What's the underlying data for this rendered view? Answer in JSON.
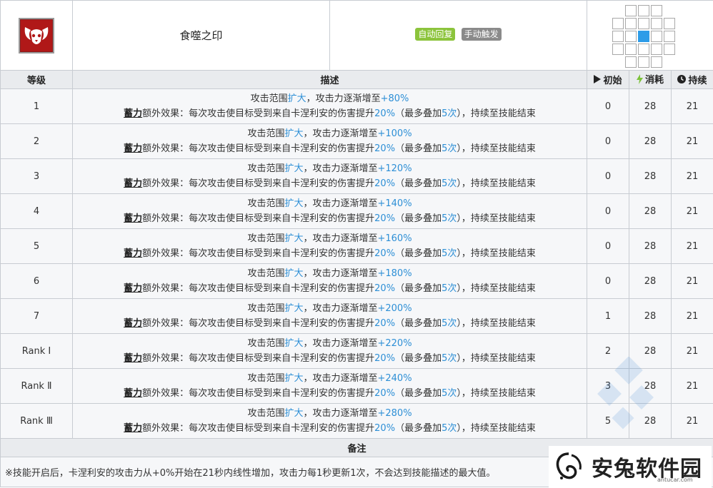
{
  "skill": {
    "name": "食噬之印",
    "tags": [
      "自动回复",
      "手动触发"
    ],
    "icon": "ram-skull-icon"
  },
  "range_grid": [
    [
      0,
      1,
      1,
      1,
      0,
      0
    ],
    [
      1,
      1,
      1,
      1,
      1,
      0
    ],
    [
      1,
      1,
      2,
      1,
      1,
      0
    ],
    [
      1,
      1,
      1,
      1,
      1,
      0
    ],
    [
      0,
      1,
      1,
      1,
      0,
      0
    ]
  ],
  "header": {
    "level": "等级",
    "desc": "描述",
    "initial": "初始",
    "cost": "消耗",
    "duration": "持续"
  },
  "rows": [
    {
      "level": "1",
      "range": "扩大",
      "atk": "+80%",
      "initial": "0",
      "cost": "28",
      "duration": "21"
    },
    {
      "level": "2",
      "range": "扩大",
      "atk": "+100%",
      "initial": "0",
      "cost": "28",
      "duration": "21"
    },
    {
      "level": "3",
      "range": "扩大",
      "atk": "+120%",
      "initial": "0",
      "cost": "28",
      "duration": "21"
    },
    {
      "level": "4",
      "range": "扩大",
      "atk": "+140%",
      "initial": "0",
      "cost": "28",
      "duration": "21"
    },
    {
      "level": "5",
      "range": "扩大",
      "atk": "+160%",
      "initial": "0",
      "cost": "28",
      "duration": "21"
    },
    {
      "level": "6",
      "range": "扩大",
      "atk": "+180%",
      "initial": "0",
      "cost": "28",
      "duration": "21"
    },
    {
      "level": "7",
      "range": "扩大",
      "atk": "+200%",
      "initial": "1",
      "cost": "28",
      "duration": "21"
    },
    {
      "level": "Rank Ⅰ",
      "range": "扩大",
      "atk": "+220%",
      "initial": "2",
      "cost": "28",
      "duration": "21"
    },
    {
      "level": "Rank Ⅱ",
      "range": "扩大",
      "atk": "+240%",
      "initial": "3",
      "cost": "28",
      "duration": "21"
    },
    {
      "level": "Rank Ⅲ",
      "range": "扩大",
      "atk": "+280%",
      "initial": "5",
      "cost": "28",
      "duration": "21"
    }
  ],
  "desc_parts": {
    "line1_a": "攻击范围",
    "line1_b": "，攻击力逐渐增至",
    "charge": "蓄力",
    "line2_a": "额外效果：每次攻击使目标受到来自卡涅利安的伤害提升",
    "pct": "20%",
    "line2_b": "（最多叠加",
    "stack": "5次",
    "line2_c": "），持续至技能结束"
  },
  "note": {
    "header": "备注",
    "text": "※技能开启后，卡涅利安的攻击力从+0%开始在21秒内线性增加，攻击力每1秒更新1次，不会达到技能描述的最大值。"
  },
  "watermark": {
    "text": "安兔软件园",
    "sub": "antucar.com"
  },
  "colors": {
    "accent_blue": "#2d8fd6",
    "tag_green": "#8cc43c",
    "tag_gray": "#8a8a8a",
    "range_center": "#2d9ce8"
  }
}
